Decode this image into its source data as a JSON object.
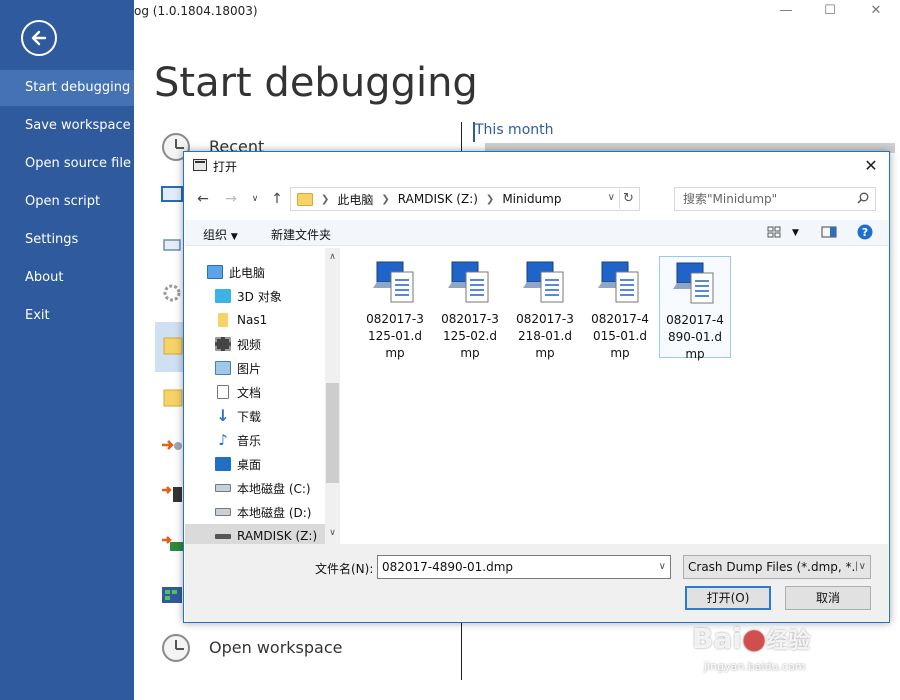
{
  "window": {
    "title": "og (1.0.1804.18003)"
  },
  "sidebar": {
    "items": [
      {
        "label": "Start debugging",
        "active": true
      },
      {
        "label": "Save workspace"
      },
      {
        "label": "Open source file"
      },
      {
        "label": "Open script"
      },
      {
        "label": "Settings"
      },
      {
        "label": "About"
      },
      {
        "label": "Exit"
      }
    ]
  },
  "main": {
    "heading": "Start debugging",
    "recent_label": "Recent",
    "open_workspace_label": "Open workspace",
    "this_month_label": "This month"
  },
  "dialog": {
    "title": "打开",
    "breadcrumb": [
      "此电脑",
      "RAMDISK (Z:)",
      "Minidump"
    ],
    "search_placeholder": "搜索\"Minidump\"",
    "toolbar": {
      "organize_label": "组织",
      "new_folder_label": "新建文件夹"
    },
    "nav_tree": [
      {
        "label": "此电脑",
        "icon": "pc-icon"
      },
      {
        "label": "3D 对象",
        "icon": "3d-objects-icon"
      },
      {
        "label": "Nas1",
        "icon": "user-folder-icon"
      },
      {
        "label": "视频",
        "icon": "video-icon"
      },
      {
        "label": "图片",
        "icon": "pictures-icon"
      },
      {
        "label": "文档",
        "icon": "documents-icon"
      },
      {
        "label": "下载",
        "icon": "download-icon"
      },
      {
        "label": "音乐",
        "icon": "music-icon"
      },
      {
        "label": "桌面",
        "icon": "desktop-icon"
      },
      {
        "label": "本地磁盘 (C:)",
        "icon": "drive-icon"
      },
      {
        "label": "本地磁盘 (D:)",
        "icon": "drive-icon"
      },
      {
        "label": "RAMDISK (Z:)",
        "icon": "drive-icon",
        "selected": true
      }
    ],
    "files": [
      {
        "name": "082017-3125-01.dmp"
      },
      {
        "name": "082017-3125-02.dmp"
      },
      {
        "name": "082017-3218-01.dmp"
      },
      {
        "name": "082017-4015-01.dmp"
      },
      {
        "name": "082017-4890-01.dmp",
        "focused": true
      }
    ],
    "filename_label": "文件名(N):",
    "filename_value": "082017-4890-01.dmp",
    "filetype_value": "Crash Dump Files (*.dmp, *.h",
    "open_button": "打开(O)",
    "cancel_button": "取消"
  },
  "colors": {
    "sidebar_bg": "#2f5a9e",
    "sidebar_active": "#4572b3",
    "accent": "#1e72c8"
  },
  "watermark": {
    "brand": "Bai",
    "brand_cn": "经验",
    "url": "jingyan.baidu.com"
  }
}
